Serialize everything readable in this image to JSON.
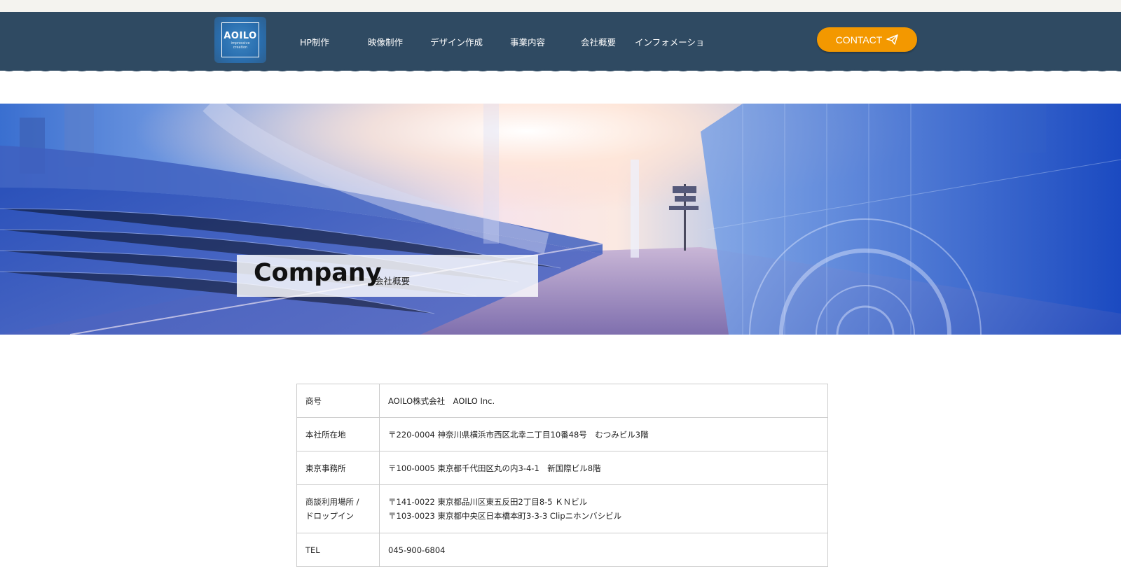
{
  "header": {
    "logo": {
      "main": "AOILO",
      "sub_lines": [
        "impressive",
        "creation"
      ]
    },
    "nav": [
      "HP制作",
      "映像制作",
      "デザイン作成",
      "事業内容",
      "会社概要",
      "インフォメーショ"
    ],
    "contact_label": "CONTACT",
    "colors": {
      "bar": "#2f4a62",
      "contact": "#f39800"
    }
  },
  "hero": {
    "title": "Company",
    "subtitle": "会社概要"
  },
  "company_table": {
    "rows": [
      {
        "key": "商号",
        "value": [
          "AOILO株式会社　AOILO Inc."
        ]
      },
      {
        "key": "本社所在地",
        "value": [
          "〒220-0004 神奈川県横浜市西区北幸二丁目10番48号　むつみビル3階"
        ]
      },
      {
        "key": "東京事務所",
        "value": [
          "〒100-0005 東京都千代田区丸の内3-4-1　新国際ビル8階"
        ]
      },
      {
        "key": "商談利用場所 / ドロップイン",
        "key_lines": [
          "商談利用場所 /",
          "ドロップイン"
        ],
        "value": [
          "〒141-0022 東京都品川区東五反田2丁目8-5 ＫＮビル",
          "〒103-0023 東京都中央区日本橋本町3-3-3 Clipニホンバシビル"
        ]
      },
      {
        "key": "TEL",
        "value": [
          "045-900-6804"
        ]
      }
    ]
  },
  "icons": {
    "contact": "paper-plane-icon"
  }
}
